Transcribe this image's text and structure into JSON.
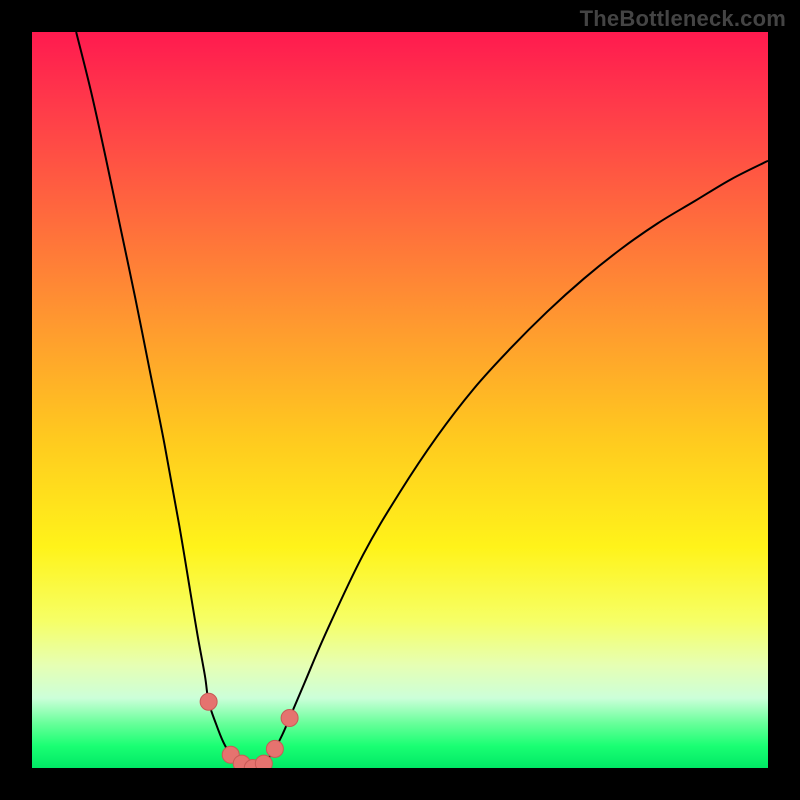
{
  "watermark": "TheBottleneck.com",
  "colors": {
    "frame": "#000000",
    "curve": "#000000",
    "marker_fill": "#e5736f",
    "marker_stroke": "#c85a56",
    "gradient_stops": [
      {
        "offset": 0.0,
        "color": "#ff1a4f"
      },
      {
        "offset": 0.1,
        "color": "#ff3a4a"
      },
      {
        "offset": 0.25,
        "color": "#ff6a3d"
      },
      {
        "offset": 0.4,
        "color": "#ff9a2f"
      },
      {
        "offset": 0.55,
        "color": "#ffc91f"
      },
      {
        "offset": 0.7,
        "color": "#fff31a"
      },
      {
        "offset": 0.8,
        "color": "#f6ff66"
      },
      {
        "offset": 0.86,
        "color": "#e6ffb3"
      },
      {
        "offset": 0.905,
        "color": "#ccffd9"
      },
      {
        "offset": 0.94,
        "color": "#66ff99"
      },
      {
        "offset": 0.97,
        "color": "#1aff73"
      },
      {
        "offset": 1.0,
        "color": "#00e865"
      }
    ]
  },
  "chart_data": {
    "type": "line",
    "title": "",
    "xlabel": "",
    "ylabel": "",
    "xlim": [
      0,
      100
    ],
    "ylim": [
      0,
      100
    ],
    "grid": false,
    "legend": false,
    "series": [
      {
        "name": "left-branch",
        "x": [
          6,
          8,
          10,
          12,
          14,
          16,
          18,
          20,
          21.5,
          22.5,
          23.5,
          24,
          25,
          26,
          27,
          28,
          29,
          30
        ],
        "y": [
          100,
          92,
          83,
          73.5,
          64,
          54,
          44,
          33,
          24,
          18,
          12.5,
          9,
          6,
          3.5,
          1.8,
          0.8,
          0.2,
          0
        ]
      },
      {
        "name": "right-branch",
        "x": [
          30,
          31,
          32,
          33,
          34,
          35,
          37,
          40,
          45,
          50,
          55,
          60,
          65,
          70,
          75,
          80,
          85,
          90,
          95,
          100
        ],
        "y": [
          0,
          0.3,
          1.2,
          2.6,
          4.5,
          6.8,
          11.5,
          18.5,
          29,
          37.5,
          45,
          51.5,
          57,
          62,
          66.5,
          70.5,
          74,
          77,
          80,
          82.5
        ]
      }
    ],
    "markers": [
      {
        "x": 24.0,
        "y": 9.0
      },
      {
        "x": 27.0,
        "y": 1.8
      },
      {
        "x": 28.5,
        "y": 0.6
      },
      {
        "x": 30.0,
        "y": 0.0
      },
      {
        "x": 31.5,
        "y": 0.6
      },
      {
        "x": 33.0,
        "y": 2.6
      },
      {
        "x": 35.0,
        "y": 6.8
      }
    ]
  }
}
